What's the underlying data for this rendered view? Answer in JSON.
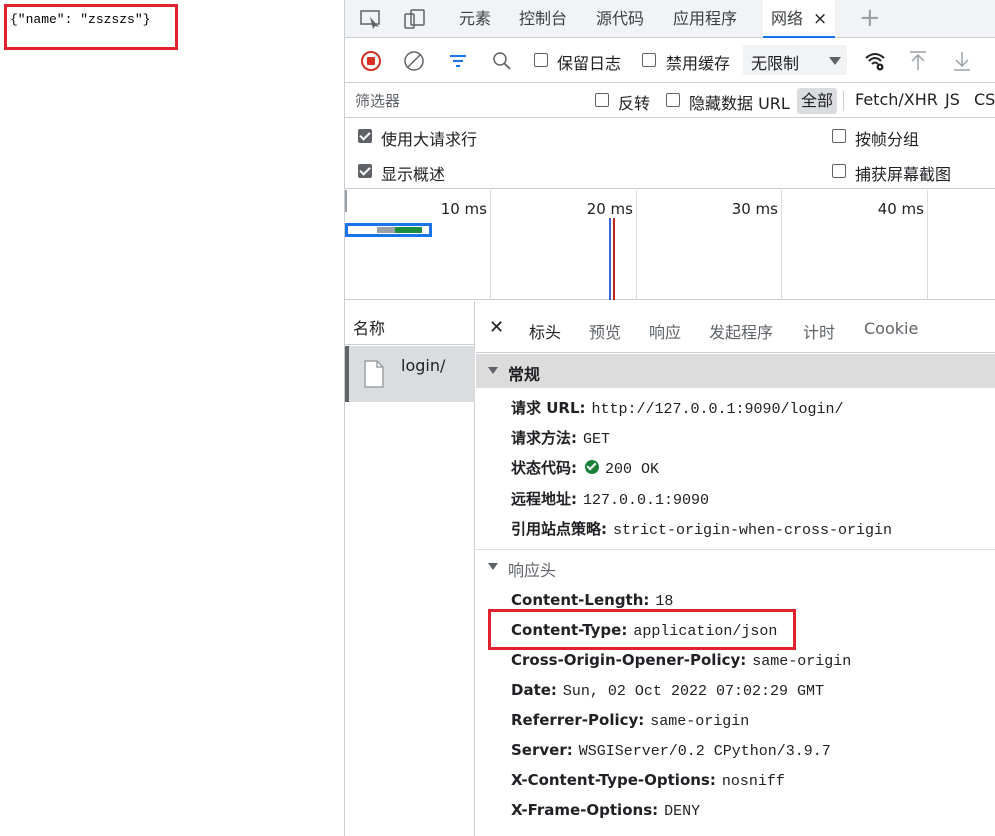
{
  "page": {
    "json_text": "{\"name\": \"zszszs\"}",
    "highlight_color": "#e0212e"
  },
  "devtools": {
    "tabs": [
      "元素",
      "控制台",
      "源代码",
      "应用程序",
      "网络"
    ],
    "active_tab": "网络",
    "close_glyph": "×",
    "toolbar": {
      "preserve_log": "保留日志",
      "disable_cache": "禁用缓存",
      "throttle": "无限制"
    },
    "filter": {
      "placeholder": "筛选器",
      "invert": "反转",
      "hide_data_urls": "隐藏数据 URL",
      "types": [
        "全部",
        "Fetch/XHR",
        "JS",
        "CSS"
      ]
    },
    "options": {
      "big_rows": "使用大请求行",
      "group_by_frame": "按帧分组",
      "show_overview": "显示概述",
      "capture_screenshots": "捕获屏幕截图"
    },
    "overview_ticks": [
      "10 ms",
      "20 ms",
      "30 ms",
      "40 ms"
    ],
    "names": {
      "header": "名称",
      "rows": [
        "login/"
      ]
    },
    "detail_tabs": [
      "标头",
      "预览",
      "响应",
      "发起程序",
      "计时",
      "Cookie"
    ],
    "general": {
      "title": "常规",
      "items": [
        {
          "k": "请求 URL:",
          "v": "http://127.0.0.1:9090/login/"
        },
        {
          "k": "请求方法:",
          "v": "GET"
        },
        {
          "k": "状态代码:",
          "v": "200 OK"
        },
        {
          "k": "远程地址:",
          "v": "127.0.0.1:9090"
        },
        {
          "k": "引用站点策略:",
          "v": "strict-origin-when-cross-origin"
        }
      ]
    },
    "response_headers": {
      "title": "响应头",
      "items": [
        {
          "k": "Content-Length:",
          "v": "18"
        },
        {
          "k": "Content-Type:",
          "v": "application/json"
        },
        {
          "k": "Cross-Origin-Opener-Policy:",
          "v": "same-origin"
        },
        {
          "k": "Date:",
          "v": "Sun, 02 Oct 2022 07:02:29 GMT"
        },
        {
          "k": "Referrer-Policy:",
          "v": "same-origin"
        },
        {
          "k": "Server:",
          "v": "WSGIServer/0.2 CPython/3.9.7"
        },
        {
          "k": "X-Content-Type-Options:",
          "v": "nosniff"
        },
        {
          "k": "X-Frame-Options:",
          "v": "DENY"
        }
      ]
    }
  }
}
